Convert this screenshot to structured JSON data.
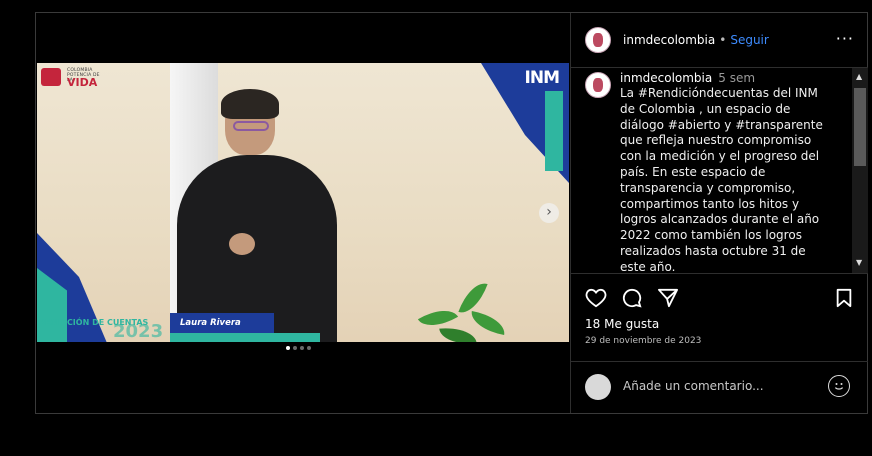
{
  "header": {
    "username": "inmdecolombia",
    "separator": "•",
    "follow_label": "Seguir",
    "more_icon": "more-horizontal-icon",
    "more_label": "···"
  },
  "media": {
    "logo_colombia_small": "COLOMBIA POTENCIA DE LA",
    "logo_colombia_big": "VIDA",
    "logo_inm": "INM",
    "banner_text": "RENDICIÓN DE CUENTAS",
    "banner_year": "2023",
    "name_plate": "Laura Rivera",
    "next_icon": "chevron-right-icon",
    "next_label": "›",
    "carousel_dots": [
      true,
      false,
      false,
      false
    ]
  },
  "caption": {
    "username": "inmdecolombia",
    "time": "5 sem",
    "text": "La #Rendicióndecuentas del INM de Colombia , un espacio de diálogo #abierto y #transparente que refleja nuestro compromiso con la medición y el progreso del país. En este espacio de transparencia y compromiso, compartimos tanto los hitos y logros alcanzados durante el año 2022 como también los logros realizados hasta octubre 31 de este año."
  },
  "scrollbar": {
    "up": "▲",
    "down": "▼"
  },
  "actions": {
    "like_icon": "heart-icon",
    "comment_icon": "comment-icon",
    "share_icon": "send-icon",
    "save_icon": "bookmark-icon",
    "likes": "18 Me gusta",
    "date": "29 de noviembre de 2023"
  },
  "comment": {
    "placeholder": "Añade un comentario...",
    "emoji_icon": "emoji-icon"
  },
  "colors": {
    "accent": "#3d8bfd",
    "brand_red": "#c4253c",
    "brand_blue": "#1d3c9a",
    "brand_teal": "#2fb6a0"
  }
}
